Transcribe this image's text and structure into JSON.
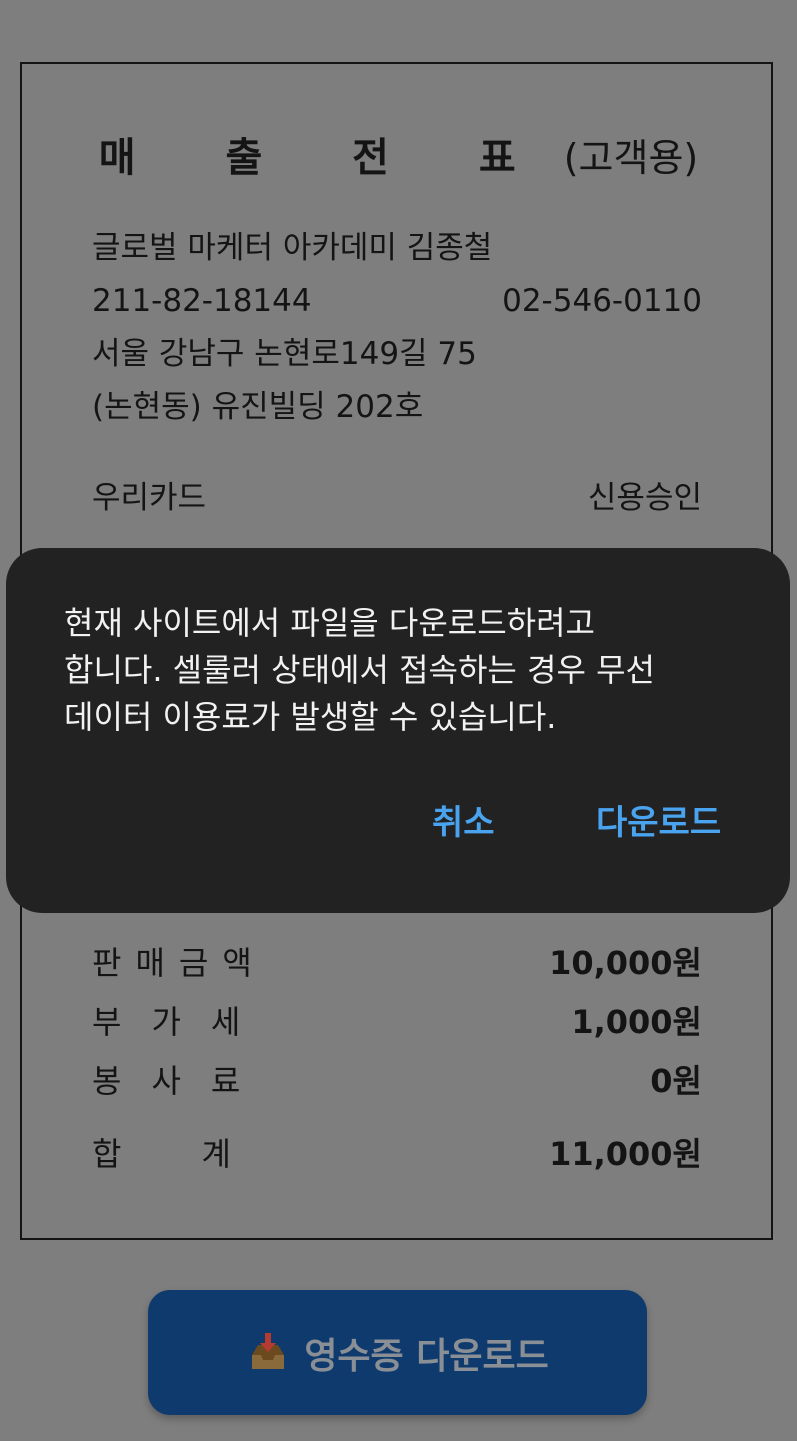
{
  "receipt": {
    "title": "매 출 전 표",
    "subtitle": "(고객용)",
    "merchant_name": "글로벌 마케터 아카데미 김종철",
    "business_number": "211-82-18144",
    "phone": "02-546-0110",
    "address_line1": "서울 강남구 논현로149길 75",
    "address_line2": "(논현동) 유진빌딩 202호",
    "card_company": "우리카드",
    "approval_type": "신용승인",
    "amounts": [
      {
        "label": "판매금액",
        "value": "10,000원"
      },
      {
        "label": "부가세",
        "value": "1,000원"
      },
      {
        "label": "봉사료",
        "value": "0원"
      },
      {
        "label": "합계",
        "value": "11,000원"
      }
    ]
  },
  "dialog": {
    "message": "현재 사이트에서 파일을 다운로드하려고\n합니다. 셀룰러 상태에서 접속하는 경우 무선\n데이터 이용료가 발생할 수 있습니다.",
    "cancel_label": "취소",
    "download_label": "다운로드",
    "accent_color": "#4aa3ef",
    "background_color": "#222222"
  },
  "download_button": {
    "label": "영수증 다운로드",
    "icon": "inbox-tray-icon",
    "color": "#0e3a6e"
  }
}
